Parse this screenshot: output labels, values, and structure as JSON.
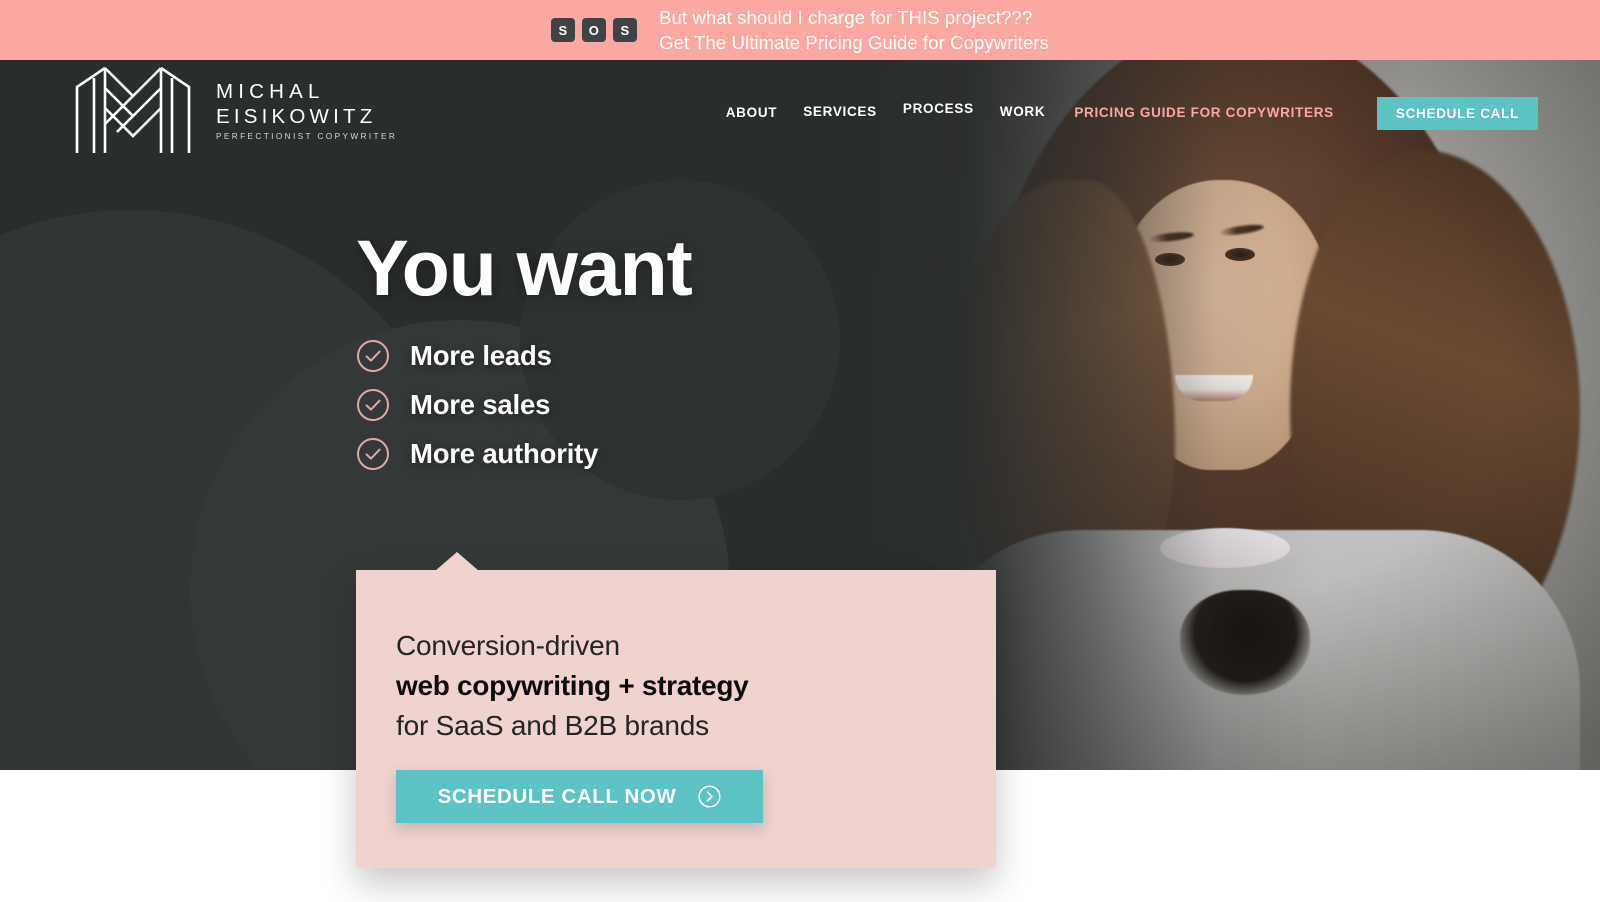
{
  "promo": {
    "keys": [
      "S",
      "O",
      "S"
    ],
    "line1": "But what should I charge for THIS project???",
    "line2": "Get The Ultimate Pricing Guide for Copywriters",
    "background": "#fba8a2"
  },
  "brand": {
    "logo_icon": "m-monogram-logo",
    "name_line1": "MICHAL",
    "name_line2": "EISIKOWITZ",
    "tagline": "PERFECTIONIST COPYWRITER"
  },
  "nav": {
    "items": [
      {
        "label": "ABOUT",
        "id": "about"
      },
      {
        "label": "SERVICES",
        "id": "services"
      },
      {
        "label": "PROCESS",
        "id": "process"
      },
      {
        "label": "WORK",
        "id": "work"
      },
      {
        "label": "PRICING GUIDE FOR COPYWRITERS",
        "id": "pricing"
      }
    ],
    "cta_label": "SCHEDULE CALL",
    "cta_color": "#5dc2c4",
    "highlight_color": "#fba8a2"
  },
  "hero": {
    "title": "You want",
    "background": "#2a2d2d",
    "checklist": [
      {
        "icon": "check-circle-icon",
        "label": "More leads"
      },
      {
        "icon": "check-circle-icon",
        "label": "More sales"
      },
      {
        "icon": "check-circle-icon",
        "label": "More authority"
      }
    ],
    "photo_alt": "portrait-of-smiling-woman"
  },
  "card": {
    "background": "#f0d2cf",
    "line1": "Conversion-driven",
    "line2": "web copywriting + strategy",
    "line3": "for SaaS and B2B brands",
    "button_label": "SCHEDULE CALL NOW",
    "button_icon": "arrow-right-circle-icon",
    "button_color": "#5dc2c4"
  }
}
